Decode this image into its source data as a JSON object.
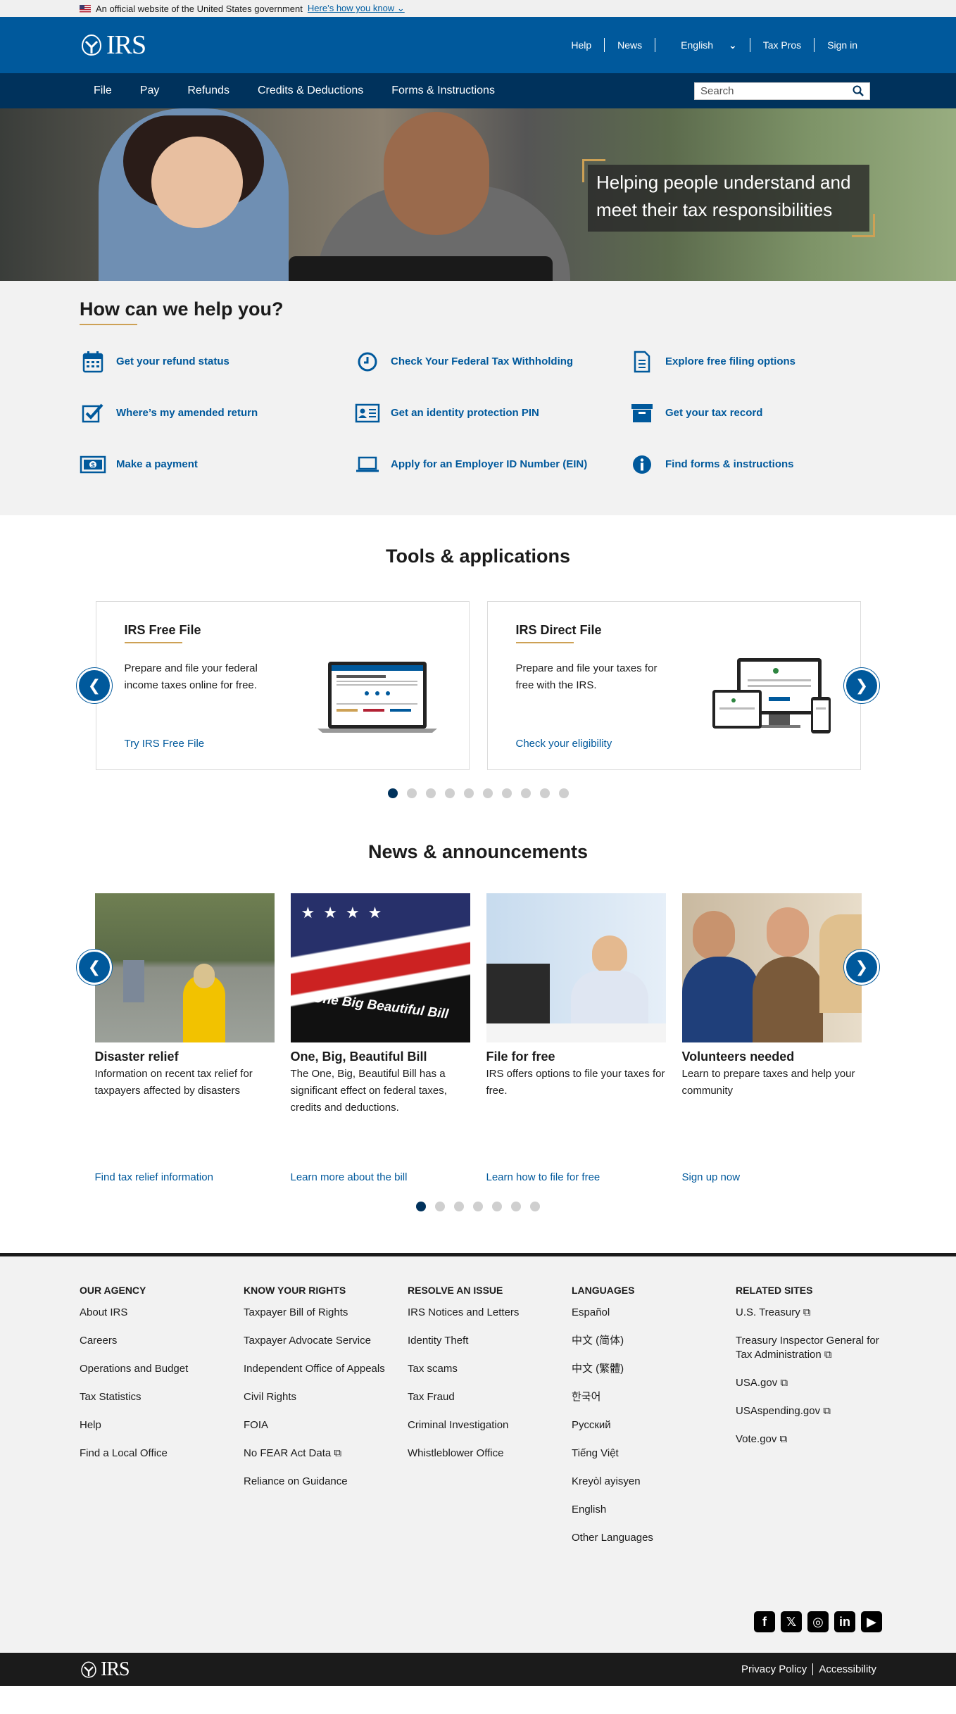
{
  "gov_banner": {
    "text": "An official website of the United States government",
    "link": "Here’s how you know"
  },
  "header": {
    "logo": "IRS",
    "links": [
      "Help",
      "News",
      "English",
      "Tax Pros",
      "Sign in"
    ]
  },
  "nav": {
    "items": [
      "File",
      "Pay",
      "Refunds",
      "Credits & Deductions",
      "Forms & Instructions"
    ],
    "search_placeholder": "Search"
  },
  "hero": {
    "text": "Helping people understand and meet their tax responsibilities"
  },
  "help": {
    "title": "How can we help you?",
    "items": [
      {
        "label": "Get your refund status",
        "icon": "calendar-icon"
      },
      {
        "label": "Check Your Federal Tax Withholding",
        "icon": "clock-icon"
      },
      {
        "label": "Explore free filing options",
        "icon": "document-icon"
      },
      {
        "label": "Where’s my amended return",
        "icon": "checkbox-icon"
      },
      {
        "label": "Get an identity protection PIN",
        "icon": "id-card-icon"
      },
      {
        "label": "Get your tax record",
        "icon": "archive-icon"
      },
      {
        "label": "Make a payment",
        "icon": "money-icon"
      },
      {
        "label": "Apply for an Employer ID Number (EIN)",
        "icon": "laptop-icon"
      },
      {
        "label": "Find forms & instructions",
        "icon": "info-icon"
      }
    ]
  },
  "tools": {
    "title": "Tools & applications",
    "cards": [
      {
        "title": "IRS Free File",
        "text": "Prepare and file your federal income taxes online for free.",
        "link": "Try IRS Free File"
      },
      {
        "title": "IRS Direct File",
        "text": "Prepare and file your taxes for free with the IRS.",
        "link": "Check your eligibility"
      }
    ],
    "dot_count": 10,
    "active_dot": 1
  },
  "news": {
    "title": "News & announcements",
    "cards": [
      {
        "title": "Disaster relief",
        "text": "Information on recent tax relief for taxpayers affected by disasters",
        "link": "Find tax relief information"
      },
      {
        "title": "One, Big, Beautiful Bill",
        "text": "The One, Big, Beautiful Bill has a significant effect on federal taxes, credits and deductions.",
        "link": "Learn more about the bill",
        "image_text": "One Big Beautiful Bill"
      },
      {
        "title": "File for free",
        "text": "IRS offers options to file your taxes for free.",
        "link": "Learn how to file for free"
      },
      {
        "title": "Volunteers needed",
        "text": "Learn to prepare taxes and help your community",
        "link": "Sign up now"
      }
    ],
    "dot_count": 7,
    "active_dot": 1
  },
  "footer": {
    "columns": [
      {
        "title": "Our Agency",
        "items": [
          "About IRS",
          "Careers",
          "Operations and Budget",
          "Tax Statistics",
          "Help",
          "Find a Local Office"
        ]
      },
      {
        "title": "Know Your Rights",
        "items": [
          "Taxpayer Bill of Rights",
          "Taxpayer Advocate Service",
          "Independent Office of Appeals",
          "Civil Rights",
          "FOIA",
          "No FEAR Act Data ⧉",
          "Reliance on Guidance"
        ]
      },
      {
        "title": "Resolve an Issue",
        "items": [
          "IRS Notices and Letters",
          "Identity Theft",
          "Tax scams",
          "Tax Fraud",
          "Criminal Investigation",
          "Whistleblower Office"
        ]
      },
      {
        "title": "Languages",
        "items": [
          "Español",
          "中文 (简体)",
          "中文 (繁體)",
          "한국어",
          "Русский",
          "Tiếng Việt",
          "Kreyòl ayisyen",
          "English",
          "Other Languages"
        ]
      },
      {
        "title": "Related Sites",
        "items": [
          "U.S. Treasury ⧉",
          "Treasury Inspector General for Tax Administration ⧉",
          "USA.gov ⧉",
          "USAspending.gov ⧉",
          "Vote.gov ⧉"
        ]
      }
    ],
    "social": [
      "facebook-icon",
      "x-icon",
      "instagram-icon",
      "linkedin-icon",
      "youtube-icon"
    ]
  },
  "bottom": {
    "logo": "IRS",
    "links": [
      "Privacy Policy",
      "Accessibility"
    ]
  }
}
